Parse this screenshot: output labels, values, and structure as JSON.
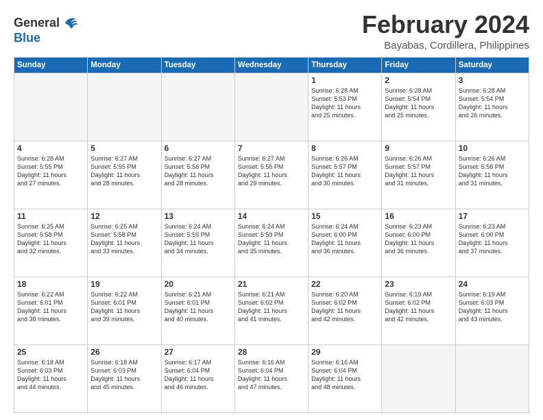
{
  "header": {
    "logo_line1": "General",
    "logo_line2": "Blue",
    "month": "February 2024",
    "location": "Bayabas, Cordillera, Philippines"
  },
  "weekdays": [
    "Sunday",
    "Monday",
    "Tuesday",
    "Wednesday",
    "Thursday",
    "Friday",
    "Saturday"
  ],
  "weeks": [
    [
      {
        "day": "",
        "info": ""
      },
      {
        "day": "",
        "info": ""
      },
      {
        "day": "",
        "info": ""
      },
      {
        "day": "",
        "info": ""
      },
      {
        "day": "1",
        "info": "Sunrise: 6:28 AM\nSunset: 5:53 PM\nDaylight: 11 hours\nand 25 minutes."
      },
      {
        "day": "2",
        "info": "Sunrise: 6:28 AM\nSunset: 5:54 PM\nDaylight: 11 hours\nand 25 minutes."
      },
      {
        "day": "3",
        "info": "Sunrise: 6:28 AM\nSunset: 5:54 PM\nDaylight: 11 hours\nand 26 minutes."
      }
    ],
    [
      {
        "day": "4",
        "info": "Sunrise: 6:28 AM\nSunset: 5:55 PM\nDaylight: 11 hours\nand 27 minutes."
      },
      {
        "day": "5",
        "info": "Sunrise: 6:27 AM\nSunset: 5:55 PM\nDaylight: 11 hours\nand 28 minutes."
      },
      {
        "day": "6",
        "info": "Sunrise: 6:27 AM\nSunset: 5:56 PM\nDaylight: 11 hours\nand 28 minutes."
      },
      {
        "day": "7",
        "info": "Sunrise: 6:27 AM\nSunset: 5:56 PM\nDaylight: 11 hours\nand 29 minutes."
      },
      {
        "day": "8",
        "info": "Sunrise: 6:26 AM\nSunset: 5:57 PM\nDaylight: 11 hours\nand 30 minutes."
      },
      {
        "day": "9",
        "info": "Sunrise: 6:26 AM\nSunset: 5:57 PM\nDaylight: 11 hours\nand 31 minutes."
      },
      {
        "day": "10",
        "info": "Sunrise: 6:26 AM\nSunset: 5:58 PM\nDaylight: 11 hours\nand 31 minutes."
      }
    ],
    [
      {
        "day": "11",
        "info": "Sunrise: 6:25 AM\nSunset: 5:58 PM\nDaylight: 11 hours\nand 32 minutes."
      },
      {
        "day": "12",
        "info": "Sunrise: 6:25 AM\nSunset: 5:58 PM\nDaylight: 11 hours\nand 33 minutes."
      },
      {
        "day": "13",
        "info": "Sunrise: 6:24 AM\nSunset: 5:59 PM\nDaylight: 11 hours\nand 34 minutes."
      },
      {
        "day": "14",
        "info": "Sunrise: 6:24 AM\nSunset: 5:59 PM\nDaylight: 11 hours\nand 35 minutes."
      },
      {
        "day": "15",
        "info": "Sunrise: 6:24 AM\nSunset: 6:00 PM\nDaylight: 11 hours\nand 36 minutes."
      },
      {
        "day": "16",
        "info": "Sunrise: 6:23 AM\nSunset: 6:00 PM\nDaylight: 11 hours\nand 36 minutes."
      },
      {
        "day": "17",
        "info": "Sunrise: 6:23 AM\nSunset: 6:00 PM\nDaylight: 11 hours\nand 37 minutes."
      }
    ],
    [
      {
        "day": "18",
        "info": "Sunrise: 6:22 AM\nSunset: 6:01 PM\nDaylight: 11 hours\nand 38 minutes."
      },
      {
        "day": "19",
        "info": "Sunrise: 6:22 AM\nSunset: 6:01 PM\nDaylight: 11 hours\nand 39 minutes."
      },
      {
        "day": "20",
        "info": "Sunrise: 6:21 AM\nSunset: 6:01 PM\nDaylight: 11 hours\nand 40 minutes."
      },
      {
        "day": "21",
        "info": "Sunrise: 6:21 AM\nSunset: 6:02 PM\nDaylight: 11 hours\nand 41 minutes."
      },
      {
        "day": "22",
        "info": "Sunrise: 6:20 AM\nSunset: 6:02 PM\nDaylight: 11 hours\nand 42 minutes."
      },
      {
        "day": "23",
        "info": "Sunrise: 6:19 AM\nSunset: 6:02 PM\nDaylight: 11 hours\nand 42 minutes."
      },
      {
        "day": "24",
        "info": "Sunrise: 6:19 AM\nSunset: 6:03 PM\nDaylight: 11 hours\nand 43 minutes."
      }
    ],
    [
      {
        "day": "25",
        "info": "Sunrise: 6:18 AM\nSunset: 6:03 PM\nDaylight: 11 hours\nand 44 minutes."
      },
      {
        "day": "26",
        "info": "Sunrise: 6:18 AM\nSunset: 6:03 PM\nDaylight: 11 hours\nand 45 minutes."
      },
      {
        "day": "27",
        "info": "Sunrise: 6:17 AM\nSunset: 6:04 PM\nDaylight: 11 hours\nand 46 minutes."
      },
      {
        "day": "28",
        "info": "Sunrise: 6:16 AM\nSunset: 6:04 PM\nDaylight: 11 hours\nand 47 minutes."
      },
      {
        "day": "29",
        "info": "Sunrise: 6:16 AM\nSunset: 6:04 PM\nDaylight: 11 hours\nand 48 minutes."
      },
      {
        "day": "",
        "info": ""
      },
      {
        "day": "",
        "info": ""
      }
    ]
  ]
}
